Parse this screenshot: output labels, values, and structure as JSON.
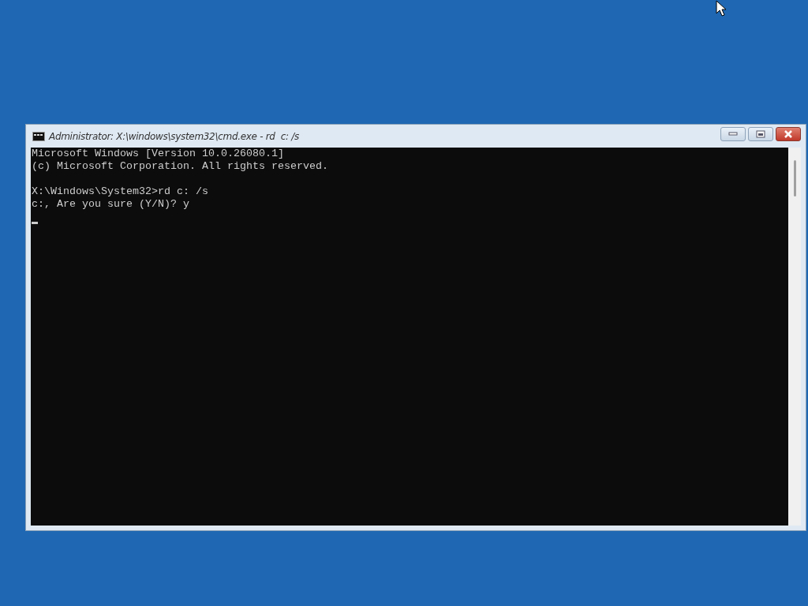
{
  "window": {
    "title": "Administrator: X:\\windows\\system32\\cmd.exe - rd  c: /s"
  },
  "console": {
    "blocks": [
      [
        "Microsoft Windows [Version 10.0.26080.1]",
        "(c) Microsoft Corporation. All rights reserved."
      ],
      [
        "X:\\Windows\\System32>rd c: /s",
        "c:, Are you sure (Y/N)? y"
      ]
    ]
  }
}
